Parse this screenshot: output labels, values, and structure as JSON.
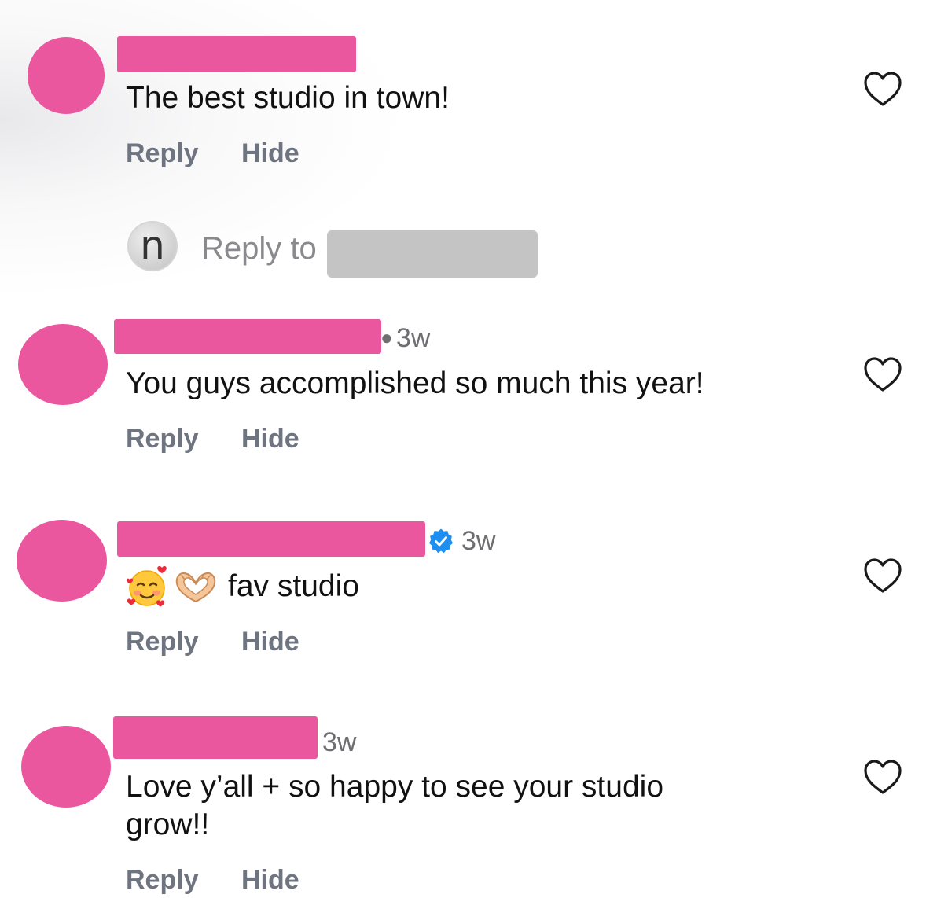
{
  "comments": [
    {
      "text": "The best studio in town!",
      "time": "",
      "verified": false,
      "reply_label": "Reply",
      "hide_label": "Hide"
    },
    {
      "text": "You guys accomplished so much this year!",
      "time": "3w",
      "verified": false,
      "reply_label": "Reply",
      "hide_label": "Hide"
    },
    {
      "text": "fav studio",
      "emoji_prefix": [
        "smiling-face-with-hearts",
        "heart-hands"
      ],
      "time": "3w",
      "verified": true,
      "reply_label": "Reply",
      "hide_label": "Hide"
    },
    {
      "text_line1": "Love y’all + so happy to see your studio",
      "text_line2": "grow!!",
      "time": "3w",
      "verified": false,
      "reply_label": "Reply",
      "hide_label": "Hide"
    }
  ],
  "reply_composer": {
    "prompt": "Reply to",
    "avatar_letter": "n"
  },
  "colors": {
    "redaction_pink": "#ea579f",
    "redaction_gray": "#c4c4c4",
    "action_gray": "#6e7480",
    "verified_blue": "#1f8ef1"
  }
}
